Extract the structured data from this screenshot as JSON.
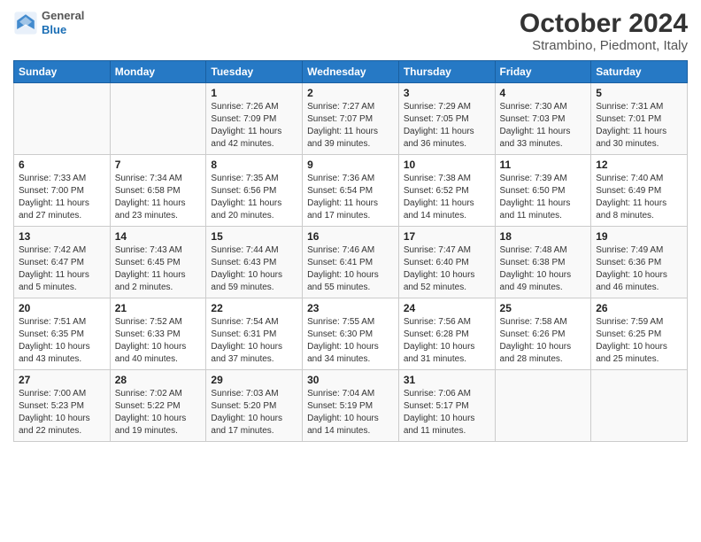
{
  "header": {
    "logo_general": "General",
    "logo_blue": "Blue",
    "title": "October 2024",
    "subtitle": "Strambino, Piedmont, Italy"
  },
  "weekdays": [
    "Sunday",
    "Monday",
    "Tuesday",
    "Wednesday",
    "Thursday",
    "Friday",
    "Saturday"
  ],
  "weeks": [
    [
      {
        "day": "",
        "sunrise": "",
        "sunset": "",
        "daylight": ""
      },
      {
        "day": "",
        "sunrise": "",
        "sunset": "",
        "daylight": ""
      },
      {
        "day": "1",
        "sunrise": "Sunrise: 7:26 AM",
        "sunset": "Sunset: 7:09 PM",
        "daylight": "Daylight: 11 hours and 42 minutes."
      },
      {
        "day": "2",
        "sunrise": "Sunrise: 7:27 AM",
        "sunset": "Sunset: 7:07 PM",
        "daylight": "Daylight: 11 hours and 39 minutes."
      },
      {
        "day": "3",
        "sunrise": "Sunrise: 7:29 AM",
        "sunset": "Sunset: 7:05 PM",
        "daylight": "Daylight: 11 hours and 36 minutes."
      },
      {
        "day": "4",
        "sunrise": "Sunrise: 7:30 AM",
        "sunset": "Sunset: 7:03 PM",
        "daylight": "Daylight: 11 hours and 33 minutes."
      },
      {
        "day": "5",
        "sunrise": "Sunrise: 7:31 AM",
        "sunset": "Sunset: 7:01 PM",
        "daylight": "Daylight: 11 hours and 30 minutes."
      }
    ],
    [
      {
        "day": "6",
        "sunrise": "Sunrise: 7:33 AM",
        "sunset": "Sunset: 7:00 PM",
        "daylight": "Daylight: 11 hours and 27 minutes."
      },
      {
        "day": "7",
        "sunrise": "Sunrise: 7:34 AM",
        "sunset": "Sunset: 6:58 PM",
        "daylight": "Daylight: 11 hours and 23 minutes."
      },
      {
        "day": "8",
        "sunrise": "Sunrise: 7:35 AM",
        "sunset": "Sunset: 6:56 PM",
        "daylight": "Daylight: 11 hours and 20 minutes."
      },
      {
        "day": "9",
        "sunrise": "Sunrise: 7:36 AM",
        "sunset": "Sunset: 6:54 PM",
        "daylight": "Daylight: 11 hours and 17 minutes."
      },
      {
        "day": "10",
        "sunrise": "Sunrise: 7:38 AM",
        "sunset": "Sunset: 6:52 PM",
        "daylight": "Daylight: 11 hours and 14 minutes."
      },
      {
        "day": "11",
        "sunrise": "Sunrise: 7:39 AM",
        "sunset": "Sunset: 6:50 PM",
        "daylight": "Daylight: 11 hours and 11 minutes."
      },
      {
        "day": "12",
        "sunrise": "Sunrise: 7:40 AM",
        "sunset": "Sunset: 6:49 PM",
        "daylight": "Daylight: 11 hours and 8 minutes."
      }
    ],
    [
      {
        "day": "13",
        "sunrise": "Sunrise: 7:42 AM",
        "sunset": "Sunset: 6:47 PM",
        "daylight": "Daylight: 11 hours and 5 minutes."
      },
      {
        "day": "14",
        "sunrise": "Sunrise: 7:43 AM",
        "sunset": "Sunset: 6:45 PM",
        "daylight": "Daylight: 11 hours and 2 minutes."
      },
      {
        "day": "15",
        "sunrise": "Sunrise: 7:44 AM",
        "sunset": "Sunset: 6:43 PM",
        "daylight": "Daylight: 10 hours and 59 minutes."
      },
      {
        "day": "16",
        "sunrise": "Sunrise: 7:46 AM",
        "sunset": "Sunset: 6:41 PM",
        "daylight": "Daylight: 10 hours and 55 minutes."
      },
      {
        "day": "17",
        "sunrise": "Sunrise: 7:47 AM",
        "sunset": "Sunset: 6:40 PM",
        "daylight": "Daylight: 10 hours and 52 minutes."
      },
      {
        "day": "18",
        "sunrise": "Sunrise: 7:48 AM",
        "sunset": "Sunset: 6:38 PM",
        "daylight": "Daylight: 10 hours and 49 minutes."
      },
      {
        "day": "19",
        "sunrise": "Sunrise: 7:49 AM",
        "sunset": "Sunset: 6:36 PM",
        "daylight": "Daylight: 10 hours and 46 minutes."
      }
    ],
    [
      {
        "day": "20",
        "sunrise": "Sunrise: 7:51 AM",
        "sunset": "Sunset: 6:35 PM",
        "daylight": "Daylight: 10 hours and 43 minutes."
      },
      {
        "day": "21",
        "sunrise": "Sunrise: 7:52 AM",
        "sunset": "Sunset: 6:33 PM",
        "daylight": "Daylight: 10 hours and 40 minutes."
      },
      {
        "day": "22",
        "sunrise": "Sunrise: 7:54 AM",
        "sunset": "Sunset: 6:31 PM",
        "daylight": "Daylight: 10 hours and 37 minutes."
      },
      {
        "day": "23",
        "sunrise": "Sunrise: 7:55 AM",
        "sunset": "Sunset: 6:30 PM",
        "daylight": "Daylight: 10 hours and 34 minutes."
      },
      {
        "day": "24",
        "sunrise": "Sunrise: 7:56 AM",
        "sunset": "Sunset: 6:28 PM",
        "daylight": "Daylight: 10 hours and 31 minutes."
      },
      {
        "day": "25",
        "sunrise": "Sunrise: 7:58 AM",
        "sunset": "Sunset: 6:26 PM",
        "daylight": "Daylight: 10 hours and 28 minutes."
      },
      {
        "day": "26",
        "sunrise": "Sunrise: 7:59 AM",
        "sunset": "Sunset: 6:25 PM",
        "daylight": "Daylight: 10 hours and 25 minutes."
      }
    ],
    [
      {
        "day": "27",
        "sunrise": "Sunrise: 7:00 AM",
        "sunset": "Sunset: 5:23 PM",
        "daylight": "Daylight: 10 hours and 22 minutes."
      },
      {
        "day": "28",
        "sunrise": "Sunrise: 7:02 AM",
        "sunset": "Sunset: 5:22 PM",
        "daylight": "Daylight: 10 hours and 19 minutes."
      },
      {
        "day": "29",
        "sunrise": "Sunrise: 7:03 AM",
        "sunset": "Sunset: 5:20 PM",
        "daylight": "Daylight: 10 hours and 17 minutes."
      },
      {
        "day": "30",
        "sunrise": "Sunrise: 7:04 AM",
        "sunset": "Sunset: 5:19 PM",
        "daylight": "Daylight: 10 hours and 14 minutes."
      },
      {
        "day": "31",
        "sunrise": "Sunrise: 7:06 AM",
        "sunset": "Sunset: 5:17 PM",
        "daylight": "Daylight: 10 hours and 11 minutes."
      },
      {
        "day": "",
        "sunrise": "",
        "sunset": "",
        "daylight": ""
      },
      {
        "day": "",
        "sunrise": "",
        "sunset": "",
        "daylight": ""
      }
    ]
  ]
}
